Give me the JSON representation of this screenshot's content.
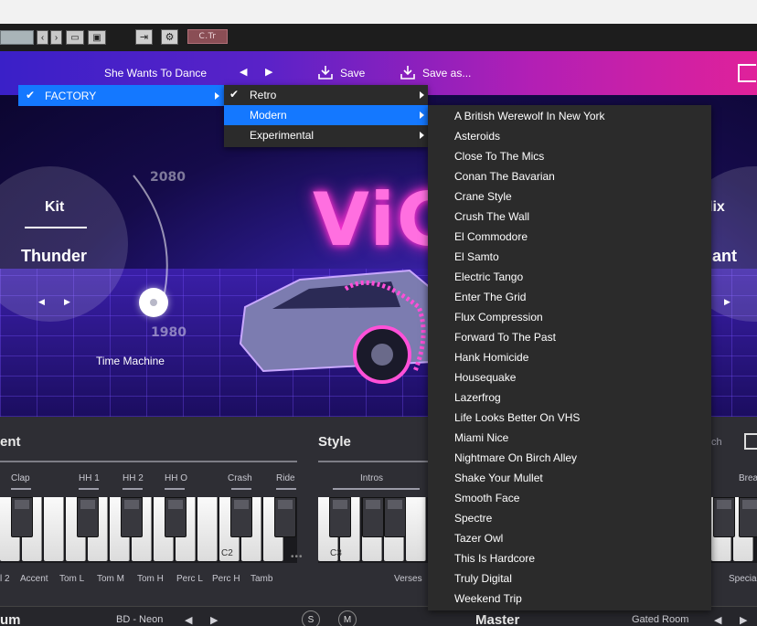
{
  "toolbar": {
    "ctr_label": "C.Tr"
  },
  "header": {
    "preset_name": "She Wants To Dance",
    "prev_arrow": "◀",
    "next_arrow": "▶",
    "save_label": "Save",
    "save_as_label": "Save as..."
  },
  "hero": {
    "kit_title": "Kit",
    "kit_value": "Thunder",
    "kit_prev": "◀",
    "kit_next": "▶",
    "year_top": "2080",
    "year_bottom": "1980",
    "time_machine_label": "Time Machine",
    "neon_text": "ViC",
    "mix_title": "lix",
    "mix_value": "gant",
    "mix_next": "▶"
  },
  "menus": {
    "level1": {
      "label": "FACTORY",
      "checked": true
    },
    "level2": [
      {
        "label": "Retro",
        "checked": true,
        "selected": false
      },
      {
        "label": "Modern",
        "checked": false,
        "selected": true
      },
      {
        "label": "Experimental",
        "checked": false,
        "selected": false
      }
    ],
    "level3": [
      "A British Werewolf In New York",
      "Asteroids",
      "Close To The Mics",
      "Conan The Bavarian",
      "Crane Style",
      "Crush The Wall",
      "El Commodore",
      "El Samto",
      "Electric Tango",
      "Enter The Grid",
      "Flux Compression",
      "Forward To The Past",
      "Hank Homicide",
      "Housequake",
      "Lazerfrog",
      "Life Looks Better On VHS",
      "Miami Nice",
      "Nightmare On Birch Alley",
      "Shake Your Mullet",
      "Smooth Face",
      "Spectre",
      "Tazer Owl",
      "This Is Hardcore",
      "Truly Digital",
      "Weekend Trip"
    ]
  },
  "lower": {
    "instrument_title": "ent",
    "style_title": "Style",
    "batch_label": "tch",
    "key_labels_top": [
      "Clap",
      "HH 1",
      "HH 2",
      "HH O",
      "Crash",
      "Ride"
    ],
    "key_labels_bottom": [
      "l 2",
      "Accent",
      "Tom L",
      "Tom M",
      "Tom H",
      "Perc L",
      "Perc H",
      "Tamb"
    ],
    "note_c2": "C2",
    "note_c3": "C3",
    "style_top_label": "Intros",
    "style_bottom_label": "Verses",
    "right_top_label": "Brea",
    "right_bottom_label": "Specia",
    "dots": "•••"
  },
  "bottom": {
    "drum_title": "um",
    "drum_preset": "BD - Neon",
    "solo": "S",
    "mute": "M",
    "master_title": "Master",
    "master_preset": "Gated Room",
    "prev": "◀",
    "next": "▶"
  },
  "colors": {
    "accent_blue": "#1478ff",
    "menu_bg": "#2b2b2b",
    "header_start": "#3a20c8",
    "header_end": "#e0219a"
  }
}
